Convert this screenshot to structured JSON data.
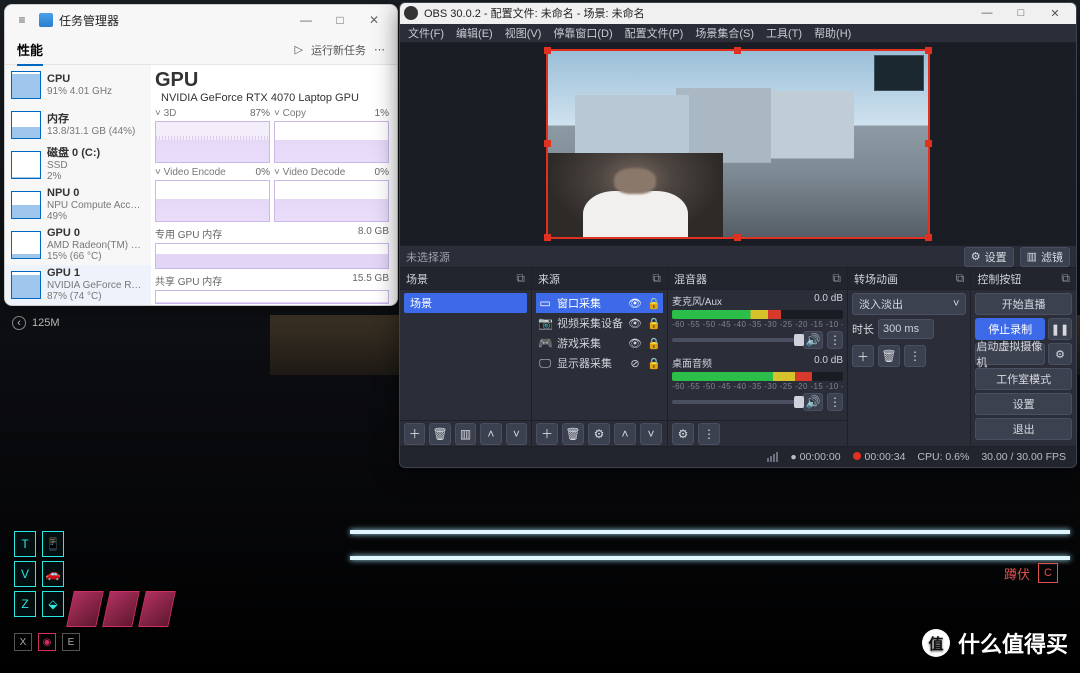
{
  "taskmgr": {
    "title": "任务管理器",
    "tab_perf": "性能",
    "run_task": "运行新任务",
    "sidebar": [
      {
        "name": "CPU",
        "sub": "91%  4.01 GHz",
        "fill": 91
      },
      {
        "name": "内存",
        "sub": "13.8/31.1 GB (44%)",
        "fill": 44
      },
      {
        "name": "磁盘 0 (C:)",
        "sub": "SSD\n2%",
        "fill": 2
      },
      {
        "name": "NPU 0",
        "sub": "NPU Compute Accel…\n49%",
        "fill": 49
      },
      {
        "name": "GPU 0",
        "sub": "AMD Radeon(TM) 8…\n15%  (66 °C)",
        "fill": 15
      },
      {
        "name": "GPU 1",
        "sub": "NVIDIA GeForce RT…\n87%  (74 °C)",
        "fill": 87
      }
    ],
    "gpu": {
      "heading": "GPU",
      "model": "NVIDIA GeForce RTX 4070 Laptop GPU",
      "tiles": [
        {
          "label": "3D",
          "pct": "87%"
        },
        {
          "label": "Copy",
          "pct": "1%"
        },
        {
          "label": "Video Encode",
          "pct": "0%"
        },
        {
          "label": "Video Decode",
          "pct": "0%"
        }
      ],
      "dedicated_label": "专用 GPU 内存",
      "dedicated_max": "8.0 GB",
      "shared_label": "共享 GPU 内存",
      "shared_max": "15.5 GB"
    }
  },
  "obs": {
    "title": "OBS 30.0.2 - 配置文件: 未命名 - 场景: 未命名",
    "menu": [
      "文件(F)",
      "编辑(E)",
      "视图(V)",
      "停靠窗口(D)",
      "配置文件(P)",
      "场景集合(S)",
      "工具(T)",
      "帮助(H)"
    ],
    "no_selection": "未选择源",
    "btn_settings_src": "设置",
    "btn_filters": "滤镜",
    "docks": {
      "scenes": {
        "title": "场景",
        "items": [
          "场景"
        ]
      },
      "sources": {
        "title": "来源",
        "items": [
          {
            "name": "窗口采集",
            "visible": true,
            "locked": true
          },
          {
            "name": "视频采集设备",
            "visible": true,
            "locked": true
          },
          {
            "name": "游戏采集",
            "visible": true,
            "locked": true
          },
          {
            "name": "显示器采集",
            "visible": false,
            "locked": true
          }
        ]
      },
      "mixer": {
        "title": "混音器",
        "channels": [
          {
            "name": "麦克风/Aux",
            "db": "0.0 dB",
            "level": 64,
            "knob": 96
          },
          {
            "name": "桌面音频",
            "db": "0.0 dB",
            "level": 82,
            "knob": 96
          }
        ],
        "scale": "-60  -55  -50  -45  -40  -35  -30  -25  -20  -15  -10  -5  0"
      },
      "transitions": {
        "title": "转场动画",
        "selected": "淡入淡出",
        "dur_label": "时长",
        "dur_value": "300 ms"
      },
      "controls": {
        "title": "控制按钮",
        "start_stream": "开始直播",
        "stop_record": "停止录制",
        "virtual_cam": "启动虚拟摄像机",
        "studio": "工作室模式",
        "settings": "设置",
        "exit": "退出"
      }
    },
    "status": {
      "live_time": "00:00:00",
      "rec_time": "00:00:34",
      "cpu": "CPU: 0.6%",
      "fps": "30.00 / 30.00 FPS"
    }
  },
  "game": {
    "money": "125M",
    "crouch_label": "蹲伏",
    "crouch_key": "C",
    "keys": {
      "t": "T",
      "v": "V",
      "z": "Z",
      "x": "X",
      "e": "E"
    }
  },
  "watermark": "什么值得买"
}
